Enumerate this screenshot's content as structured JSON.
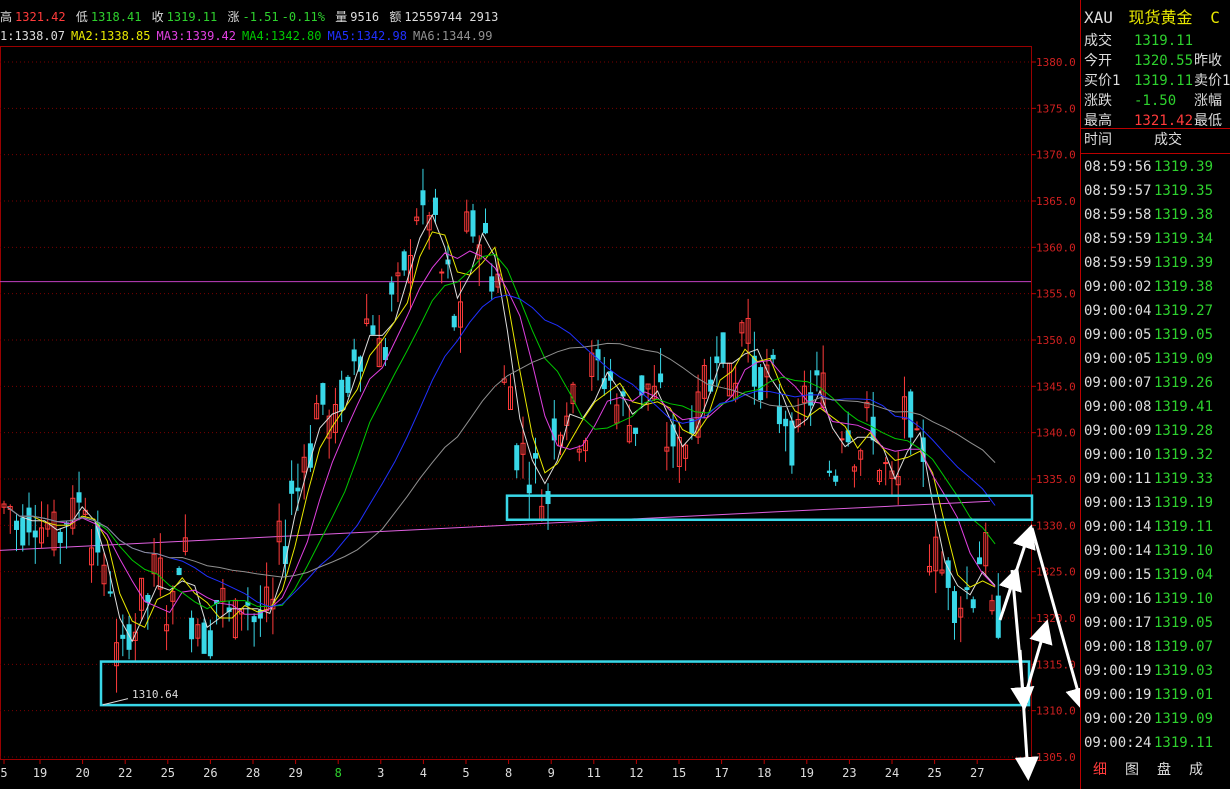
{
  "header": {
    "high_label": "高",
    "high": "1321.42",
    "low_label": "低",
    "low": "1318.41",
    "close_label": "收",
    "close": "1319.11",
    "change_label": "涨",
    "change": "-1.51",
    "change_pct": "-0.11%",
    "volume_label": "量",
    "volume": "9516",
    "amount_label": "额",
    "amount": "12559744 2913"
  },
  "ma": [
    {
      "label": "1:1338.07",
      "color": "#dddddd"
    },
    {
      "label": "MA2:1338.85",
      "color": "#e8e800"
    },
    {
      "label": "MA3:1339.42",
      "color": "#e040e0"
    },
    {
      "label": "MA4:1342.80",
      "color": "#00c800"
    },
    {
      "label": "MA5:1342.98",
      "color": "#2030ff"
    },
    {
      "label": "MA6:1344.99",
      "color": "#909090"
    }
  ],
  "colors": {
    "up": "#ff3b3b",
    "down": "#39d8e8",
    "grid": "#7a0000",
    "axis_text": "#d02020"
  },
  "annotation": "1310.64",
  "chart_data": {
    "type": "candlestick",
    "y_ticks": [
      1380,
      1375,
      1370,
      1365,
      1360,
      1355,
      1350,
      1345,
      1340,
      1335,
      1330,
      1325,
      1320,
      1315,
      1310,
      1305
    ],
    "y_tick_labels": [
      "1380.0",
      "1375.0",
      "1370.0",
      "1365.0",
      "1360.0",
      "1355.0",
      "1350.0",
      "1345.0",
      "1340.0",
      "1335.0",
      "1330.0",
      "1325.0",
      "1320.0",
      "1315.0",
      "1310.0",
      "1305.0"
    ],
    "ylim": [
      1304,
      1385
    ],
    "x_labels": [
      "5",
      "19",
      "20",
      "22",
      "25",
      "26",
      "28",
      "29",
      "8",
      "3",
      "4",
      "5",
      "8",
      "9",
      "11",
      "12",
      "15",
      "17",
      "18",
      "19",
      "23",
      "24",
      "25",
      "27"
    ],
    "x_label_highlight": "8",
    "close_path": [
      1332,
      1330,
      1331,
      1330,
      1329,
      1331,
      1333,
      1328,
      1324,
      1316,
      1319,
      1322,
      1325,
      1321,
      1327,
      1320,
      1318,
      1322,
      1320,
      1322,
      1320,
      1321,
      1328,
      1334,
      1338,
      1343,
      1341,
      1344,
      1349,
      1352,
      1349,
      1355,
      1358,
      1364,
      1363,
      1357,
      1352,
      1362,
      1361,
      1357,
      1345,
      1338,
      1336,
      1333,
      1341,
      1343,
      1340,
      1347,
      1346,
      1343,
      1341,
      1345,
      1344,
      1339,
      1338,
      1342,
      1345,
      1350,
      1345,
      1352,
      1346,
      1346,
      1342,
      1339,
      1344,
      1345,
      1336,
      1341,
      1338,
      1341,
      1336,
      1334,
      1342,
      1338,
      1327,
      1325,
      1322,
      1323,
      1327,
      1320
    ],
    "resistance_level": 1356.3,
    "support_box_upper": [
      1333.2,
      1330.6
    ],
    "support_box_lower": [
      1315.3,
      1310.6
    ]
  },
  "panel": {
    "symbol": "XAU",
    "name": "现货黄金",
    "name_suffix": "C",
    "quote": [
      {
        "label": "成交",
        "value": "1319.11",
        "value_color": "#2ed12e",
        "label2": ""
      },
      {
        "label": "今开",
        "value": "1320.55",
        "value_color": "#2ed12e",
        "label2": "昨收"
      },
      {
        "label": "买价1",
        "value": "1319.11",
        "value_color": "#2ed12e",
        "label2": "卖价1"
      },
      {
        "label": "涨跌",
        "value": "-1.50",
        "value_color": "#2ed12e",
        "label2": "涨幅"
      },
      {
        "label": "最高",
        "value": "1321.42",
        "value_color": "#ff3b3b",
        "label2": "最低"
      }
    ],
    "ticks_header": {
      "time": "时间",
      "price": "成交"
    },
    "ticks": [
      {
        "time": "08:59:56",
        "price": "1319.39"
      },
      {
        "time": "08:59:57",
        "price": "1319.35"
      },
      {
        "time": "08:59:58",
        "price": "1319.38"
      },
      {
        "time": "08:59:59",
        "price": "1319.34"
      },
      {
        "time": "08:59:59",
        "price": "1319.39"
      },
      {
        "time": "09:00:02",
        "price": "1319.38"
      },
      {
        "time": "09:00:04",
        "price": "1319.27"
      },
      {
        "time": "09:00:05",
        "price": "1319.05"
      },
      {
        "time": "09:00:05",
        "price": "1319.09"
      },
      {
        "time": "09:00:07",
        "price": "1319.26"
      },
      {
        "time": "09:00:08",
        "price": "1319.41"
      },
      {
        "time": "09:00:09",
        "price": "1319.28"
      },
      {
        "time": "09:00:10",
        "price": "1319.32"
      },
      {
        "time": "09:00:11",
        "price": "1319.33"
      },
      {
        "time": "09:00:13",
        "price": "1319.19"
      },
      {
        "time": "09:00:14",
        "price": "1319.11"
      },
      {
        "time": "09:00:14",
        "price": "1319.10"
      },
      {
        "time": "09:00:15",
        "price": "1319.04"
      },
      {
        "time": "09:00:16",
        "price": "1319.10"
      },
      {
        "time": "09:00:17",
        "price": "1319.05"
      },
      {
        "time": "09:00:18",
        "price": "1319.07"
      },
      {
        "time": "09:00:19",
        "price": "1319.03"
      },
      {
        "time": "09:00:19",
        "price": "1319.01"
      },
      {
        "time": "09:00:20",
        "price": "1319.09"
      },
      {
        "time": "09:00:24",
        "price": "1319.11"
      }
    ],
    "tabs": [
      "细",
      "图",
      "盘",
      "成"
    ]
  }
}
